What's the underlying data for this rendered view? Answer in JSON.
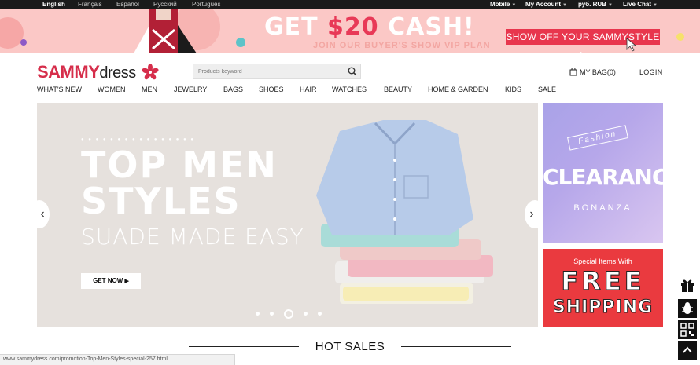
{
  "topbar": {
    "languages": [
      "English",
      "Français",
      "Español",
      "Русский",
      "Português"
    ],
    "active_language": "English",
    "mobile_label": "Mobile",
    "account_label": "My Account",
    "currency_label": "руб. RUB",
    "chat_label": "Live Chat"
  },
  "promo": {
    "headline_prefix": "GET ",
    "amount": "$20",
    "headline_suffix": " CASH!",
    "subline": "JOIN OUR BUYER'S SHOW VIP PLAN",
    "cta_label": "SHOW OFF YOUR SAMMYSTYLE"
  },
  "header": {
    "logo_main": "SAMMY",
    "logo_sub": "dress",
    "search_placeholder": "Products keyword",
    "bag_label": "MY BAG(0)",
    "login_label": "LOGIN"
  },
  "nav": [
    "WHAT'S NEW",
    "WOMEN",
    "MEN",
    "JEWELRY",
    "BAGS",
    "SHOES",
    "HAIR",
    "WATCHES",
    "BEAUTY",
    "HOME & GARDEN",
    "KIDS",
    "SALE"
  ],
  "hero": {
    "title_line1": "TOP MEN",
    "title_line2": "STYLES",
    "subtitle": "SUADE MADE EASY",
    "button_label": "GET NOW",
    "slide_count": 5,
    "active_slide": 3
  },
  "side_tiles": {
    "tile1_tag": "Fashion",
    "tile1_title": "CLEARANCE",
    "tile1_sub": "BONANZA",
    "tile2_top": "Special Items With",
    "tile2_free": "FREE",
    "tile2_shipping": "SHIPPING"
  },
  "section": {
    "hot_sales": "HOT SALES"
  },
  "status_url": "www.sammydress.com/promotion-Top-Men-Styles-special-257.html",
  "colors": {
    "brand_red": "#d62e4b",
    "promo_pink": "#fbc8c6",
    "cta_red": "#e8364d",
    "topbar_dark": "#1a1a1a"
  }
}
